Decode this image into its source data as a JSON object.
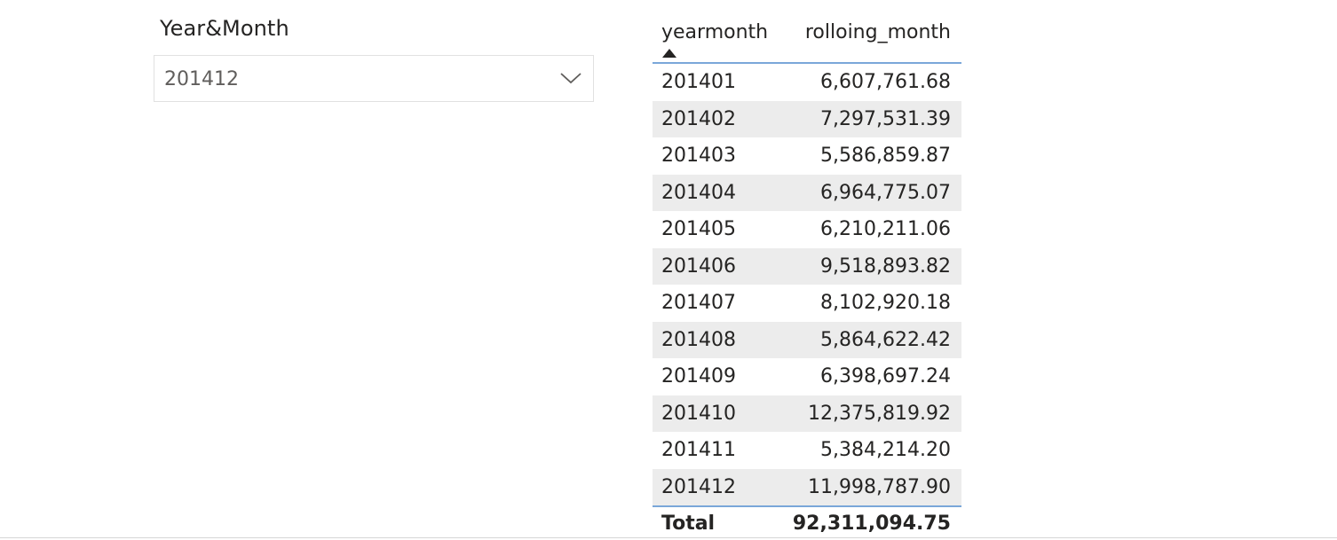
{
  "slicer": {
    "title": "Year&Month",
    "selected_value": "201412",
    "dropdown_icon": "chevron-down-icon"
  },
  "table": {
    "columns": [
      "yearmonth",
      "rolloing_month"
    ],
    "sort_icon": "sort-ascending-icon",
    "sort_column": "yearmonth",
    "rows": [
      {
        "yearmonth": "201401",
        "value": "6,607,761.68"
      },
      {
        "yearmonth": "201402",
        "value": "7,297,531.39"
      },
      {
        "yearmonth": "201403",
        "value": "5,586,859.87"
      },
      {
        "yearmonth": "201404",
        "value": "6,964,775.07"
      },
      {
        "yearmonth": "201405",
        "value": "6,210,211.06"
      },
      {
        "yearmonth": "201406",
        "value": "9,518,893.82"
      },
      {
        "yearmonth": "201407",
        "value": "8,102,920.18"
      },
      {
        "yearmonth": "201408",
        "value": "5,864,622.42"
      },
      {
        "yearmonth": "201409",
        "value": "6,398,697.24"
      },
      {
        "yearmonth": "201410",
        "value": "12,375,819.92"
      },
      {
        "yearmonth": "201411",
        "value": "5,384,214.20"
      },
      {
        "yearmonth": "201412",
        "value": "11,998,787.90"
      }
    ],
    "total_label": "Total",
    "total_value": "92,311,094.75"
  },
  "colors": {
    "header_rule": "#7aa7d9",
    "alt_row": "#ececec",
    "text": "#252423"
  }
}
